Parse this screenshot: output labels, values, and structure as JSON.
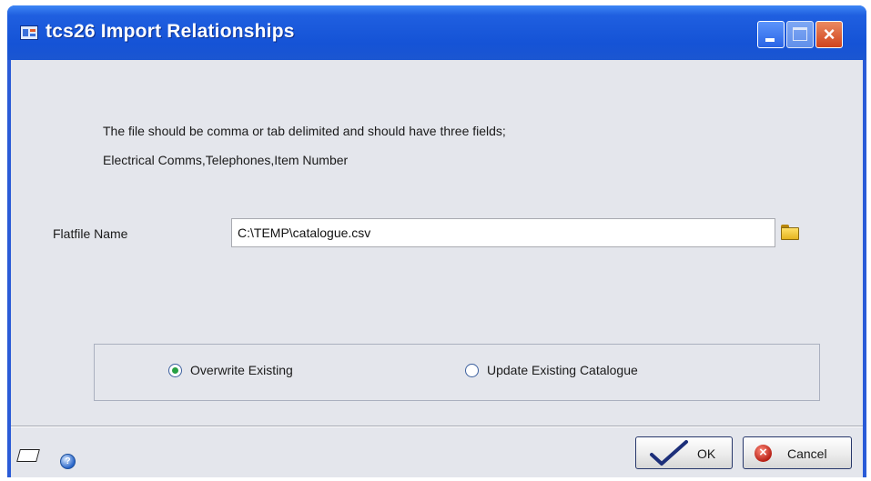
{
  "window": {
    "title": "tcs26 Import Relationships",
    "controls": [
      "minimize",
      "maximize",
      "close"
    ]
  },
  "instructions": {
    "line1": "The file should be comma or tab delimited and should have  three fields;",
    "line2": "Electrical Comms,Telephones,Item Number"
  },
  "flatfile": {
    "label": "Flatfile Name",
    "value": "C:\\TEMP\\catalogue.csv",
    "browse_icon": "folder-icon"
  },
  "import_mode": {
    "options": [
      {
        "label": "Overwrite Existing",
        "selected": true
      },
      {
        "label": "Update Existing Catalogue",
        "selected": false
      }
    ]
  },
  "footer": {
    "left_icons": [
      "note-icon",
      "help-icon"
    ],
    "ok_label": "OK",
    "cancel_label": "Cancel"
  },
  "colors": {
    "titlebar": "#1553d6",
    "client_background": "#e4e6ec",
    "radio_selected": "#27a043",
    "close_button": "#d0431c"
  }
}
